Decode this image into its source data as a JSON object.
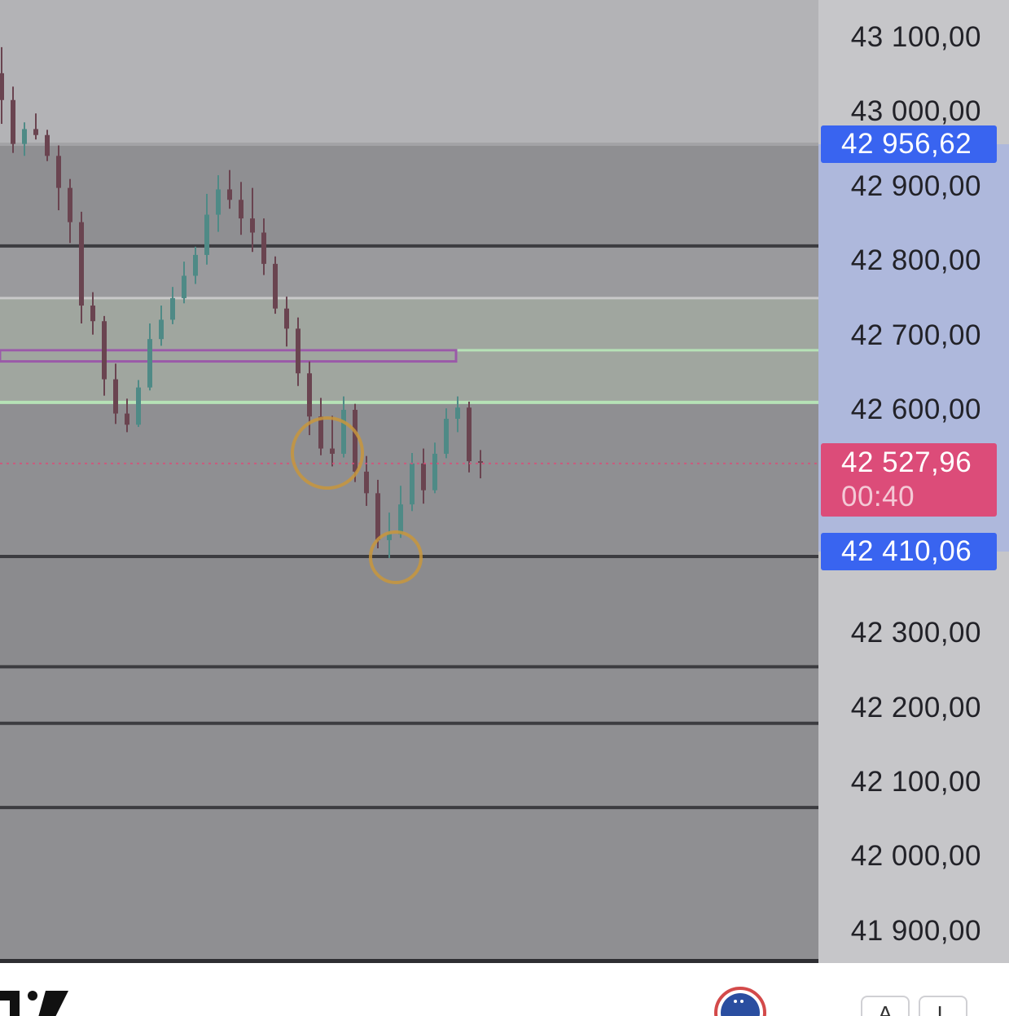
{
  "price_axis": {
    "ticks": [
      "43 100,00",
      "43 000,00",
      "42 900,00",
      "42 800,00",
      "42 700,00",
      "42 600,00",
      "42 300,00",
      "42 200,00",
      "42 100,00",
      "42 000,00",
      "41 900,00"
    ],
    "high_tag": "42 956,62",
    "current_price": "42 527,96",
    "countdown": "00:40",
    "low_tag": "42 410,06"
  },
  "colors": {
    "up_candle": "#4f8a86",
    "down_candle": "#6a4450",
    "range_tag": "#3964f0",
    "current_tag": "#dc4c79",
    "zone_green": "#b6e2b6",
    "marker_circle": "#c8963c"
  },
  "chart_data": {
    "type": "candlestick",
    "price_scale": {
      "min": 41860,
      "max": 43140,
      "tick_step": 100
    },
    "visible_range": {
      "high": 42956.62,
      "low": 42410.06
    },
    "current_price": 42527.96,
    "horizontal_levels": [
      42820.0,
      42403.0,
      42255.0,
      42179.0,
      42066.0,
      41856.0
    ],
    "zones": [
      {
        "kind": "range-band",
        "from": 42410.06,
        "to": 42956.62,
        "color": "#aeb8dc"
      },
      {
        "kind": "supply-demand",
        "from": 42610.0,
        "to": 42750.0,
        "color": "#b6e2b6"
      },
      {
        "kind": "box",
        "from": 42665.0,
        "to": 42680.0,
        "color": "#9a5aa8"
      }
    ],
    "markers": [
      {
        "type": "circle",
        "price": 42542,
        "candle_index": 28
      },
      {
        "type": "circle",
        "price": 42402,
        "candle_index": 34
      }
    ],
    "candles_ohlc": [
      [
        43052,
        43087,
        42984,
        43016
      ],
      [
        43016,
        43034,
        42945,
        42957
      ],
      [
        42957,
        42986,
        42941,
        42977
      ],
      [
        42977,
        42998,
        42963,
        42969
      ],
      [
        42969,
        42976,
        42934,
        42941
      ],
      [
        42941,
        42955,
        42868,
        42898
      ],
      [
        42898,
        42910,
        42824,
        42852
      ],
      [
        42852,
        42866,
        42716,
        42740
      ],
      [
        42740,
        42758,
        42701,
        42719
      ],
      [
        42719,
        42726,
        42619,
        42641
      ],
      [
        42641,
        42662,
        42581,
        42595
      ],
      [
        42595,
        42615,
        42570,
        42580
      ],
      [
        42580,
        42640,
        42577,
        42630
      ],
      [
        42630,
        42716,
        42626,
        42695
      ],
      [
        42695,
        42740,
        42686,
        42721
      ],
      [
        42721,
        42765,
        42715,
        42750
      ],
      [
        42750,
        42799,
        42743,
        42780
      ],
      [
        42780,
        42819,
        42769,
        42808
      ],
      [
        42808,
        42890,
        42795,
        42862
      ],
      [
        42862,
        42915,
        42839,
        42896
      ],
      [
        42896,
        42922,
        42870,
        42882
      ],
      [
        42882,
        42906,
        42835,
        42857
      ],
      [
        42857,
        42898,
        42812,
        42838
      ],
      [
        42838,
        42857,
        42781,
        42796
      ],
      [
        42796,
        42806,
        42729,
        42736
      ],
      [
        42736,
        42752,
        42685,
        42709
      ],
      [
        42709,
        42724,
        42632,
        42649
      ],
      [
        42649,
        42665,
        42566,
        42591
      ],
      [
        42591,
        42616,
        42539,
        42548
      ],
      [
        42548,
        42592,
        42524,
        42541
      ],
      [
        42541,
        42618,
        42536,
        42600
      ],
      [
        42600,
        42608,
        42503,
        42517
      ],
      [
        42517,
        42538,
        42471,
        42488
      ],
      [
        42488,
        42506,
        42414,
        42425
      ],
      [
        42425,
        42462,
        42401,
        42433
      ],
      [
        42433,
        42498,
        42428,
        42473
      ],
      [
        42473,
        42542,
        42464,
        42528
      ],
      [
        42528,
        42548,
        42474,
        42492
      ],
      [
        42492,
        42556,
        42488,
        42541
      ],
      [
        42541,
        42602,
        42535,
        42588
      ],
      [
        42588,
        42618,
        42570,
        42603
      ],
      [
        42603,
        42611,
        42516,
        42531
      ],
      [
        42531,
        42546,
        42508,
        42529
      ]
    ]
  }
}
